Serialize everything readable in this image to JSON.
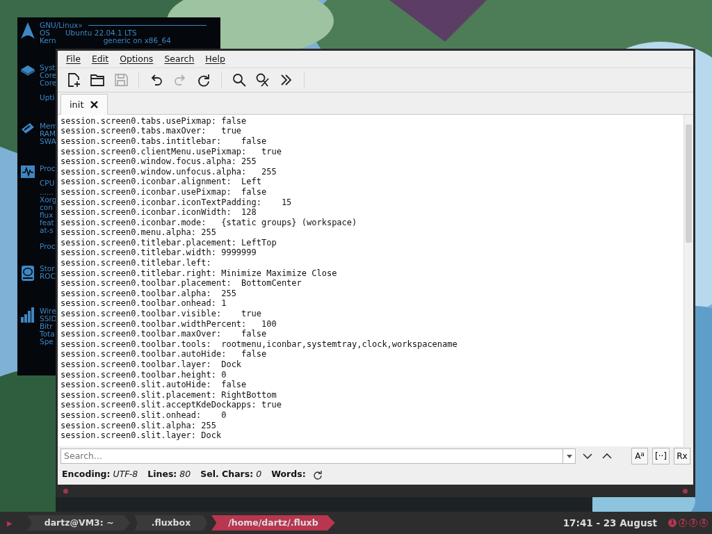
{
  "conky": {
    "sections": [
      {
        "kind": "distro",
        "lines": [
          {
            "text": "GNU/Linux»",
            "rule": true
          },
          {
            "text": "OS",
            "value": "Ubuntu 22.04.1 LTS"
          },
          {
            "text": "Kern",
            "value": "generic on x86_64"
          }
        ]
      },
      {
        "kind": "cpu",
        "lines": [
          {
            "text": "Syst"
          },
          {
            "text": "Core"
          },
          {
            "text": "Core"
          },
          {
            "text": "Upti"
          }
        ]
      },
      {
        "kind": "memory",
        "lines": [
          {
            "text": "Mem"
          },
          {
            "text": "RAM"
          },
          {
            "text": "SWA"
          }
        ]
      },
      {
        "kind": "monitor",
        "lines": [
          {
            "text": "Proc"
          },
          {
            "text": "CPU"
          },
          {
            "text": "......"
          },
          {
            "text": "Xorg"
          },
          {
            "text": "con"
          },
          {
            "text": "flux"
          },
          {
            "text": "feat"
          },
          {
            "text": "at-s"
          },
          {
            "text": "Proc"
          }
        ]
      },
      {
        "kind": "disk",
        "lines": [
          {
            "text": "Stor"
          },
          {
            "text": "ROC"
          }
        ]
      },
      {
        "kind": "signal",
        "lines": [
          {
            "text": "Wire"
          },
          {
            "text": "SSID"
          },
          {
            "text": "Bitr"
          },
          {
            "text": "Tota"
          },
          {
            "text": "Spe"
          }
        ]
      }
    ]
  },
  "editor": {
    "menu": [
      "File",
      "Edit",
      "Options",
      "Search",
      "Help"
    ],
    "toolbar": [
      {
        "kind": "new",
        "disabled": false
      },
      {
        "kind": "open",
        "disabled": false
      },
      {
        "kind": "save",
        "disabled": true
      },
      {
        "kind": "sep"
      },
      {
        "kind": "undo",
        "disabled": false
      },
      {
        "kind": "redo",
        "disabled": true
      },
      {
        "kind": "reload",
        "disabled": false
      },
      {
        "kind": "sep"
      },
      {
        "kind": "find",
        "disabled": false
      },
      {
        "kind": "replace",
        "disabled": false
      },
      {
        "kind": "more",
        "disabled": false
      },
      {
        "kind": "sep"
      }
    ],
    "tabs": [
      {
        "label": "init",
        "selected": true
      }
    ],
    "lines": [
      "session.screen0.tabs.usePixmap: false",
      "session.screen0.tabs.maxOver:   true",
      "session.screen0.tabs.intitlebar:    false",
      "session.screen0.clientMenu.usePixmap:   true",
      "session.screen0.window.focus.alpha: 255",
      "session.screen0.window.unfocus.alpha:   255",
      "session.screen0.iconbar.alignment:  Left",
      "session.screen0.iconbar.usePixmap:  false",
      "session.screen0.iconbar.iconTextPadding:    15",
      "session.screen0.iconbar.iconWidth:  128",
      "session.screen0.iconbar.mode:   {static groups} (workspace)",
      "session.screen0.menu.alpha: 255",
      "session.screen0.titlebar.placement: LeftTop",
      "session.screen0.titlebar.width: 9999999",
      "session.screen0.titlebar.left:",
      "session.screen0.titlebar.right: Minimize Maximize Close",
      "session.screen0.toolbar.placement:  BottomCenter",
      "session.screen0.toolbar.alpha:  255",
      "session.screen0.toolbar.onhead: 1",
      "session.screen0.toolbar.visible:    true",
      "session.screen0.toolbar.widthPercent:   100",
      "session.screen0.toolbar.maxOver:    false",
      "session.screen0.toolbar.tools:  rootmenu,iconbar,systemtray,clock,workspacename",
      "session.screen0.toolbar.autoHide:   false",
      "session.screen0.toolbar.layer:  Dock",
      "session.screen0.toolbar.height: 0",
      "session.screen0.slit.autoHide:  false",
      "session.screen0.slit.placement: RightBottom",
      "session.screen0.slit.acceptKdeDockapps: true",
      "session.screen0.slit.onhead:    0",
      "session.screen0.slit.alpha: 255",
      "session.screen0.slit.layer: Dock"
    ],
    "search": {
      "placeholder": "Search...",
      "options": [
        {
          "label": "A$^{a}$",
          "on": false
        },
        {
          "label": "[··]",
          "on": false
        },
        {
          "label": "Rx",
          "on": false
        }
      ]
    },
    "status": [
      {
        "label": "Encoding:",
        "value": "UTF-8"
      },
      {
        "label": "Lines:",
        "value": "80"
      },
      {
        "label": "Sel. Chars:",
        "value": "0"
      },
      {
        "label": "Words:"
      }
    ]
  },
  "taskbar": {
    "menu": "▶",
    "tasks": [
      {
        "label": "dartz@VM3: ~",
        "selected": false
      },
      {
        "label": ".fluxbox",
        "selected": false
      },
      {
        "label": "/home/dartz/.fluxb",
        "selected": true
      }
    ],
    "clock": "17:41 - 23 August",
    "workspaces": [
      {
        "label": "1",
        "selected": true
      },
      {
        "label": "2",
        "selected": false
      },
      {
        "label": "3",
        "selected": false
      },
      {
        "label": "4",
        "selected": false
      }
    ]
  }
}
